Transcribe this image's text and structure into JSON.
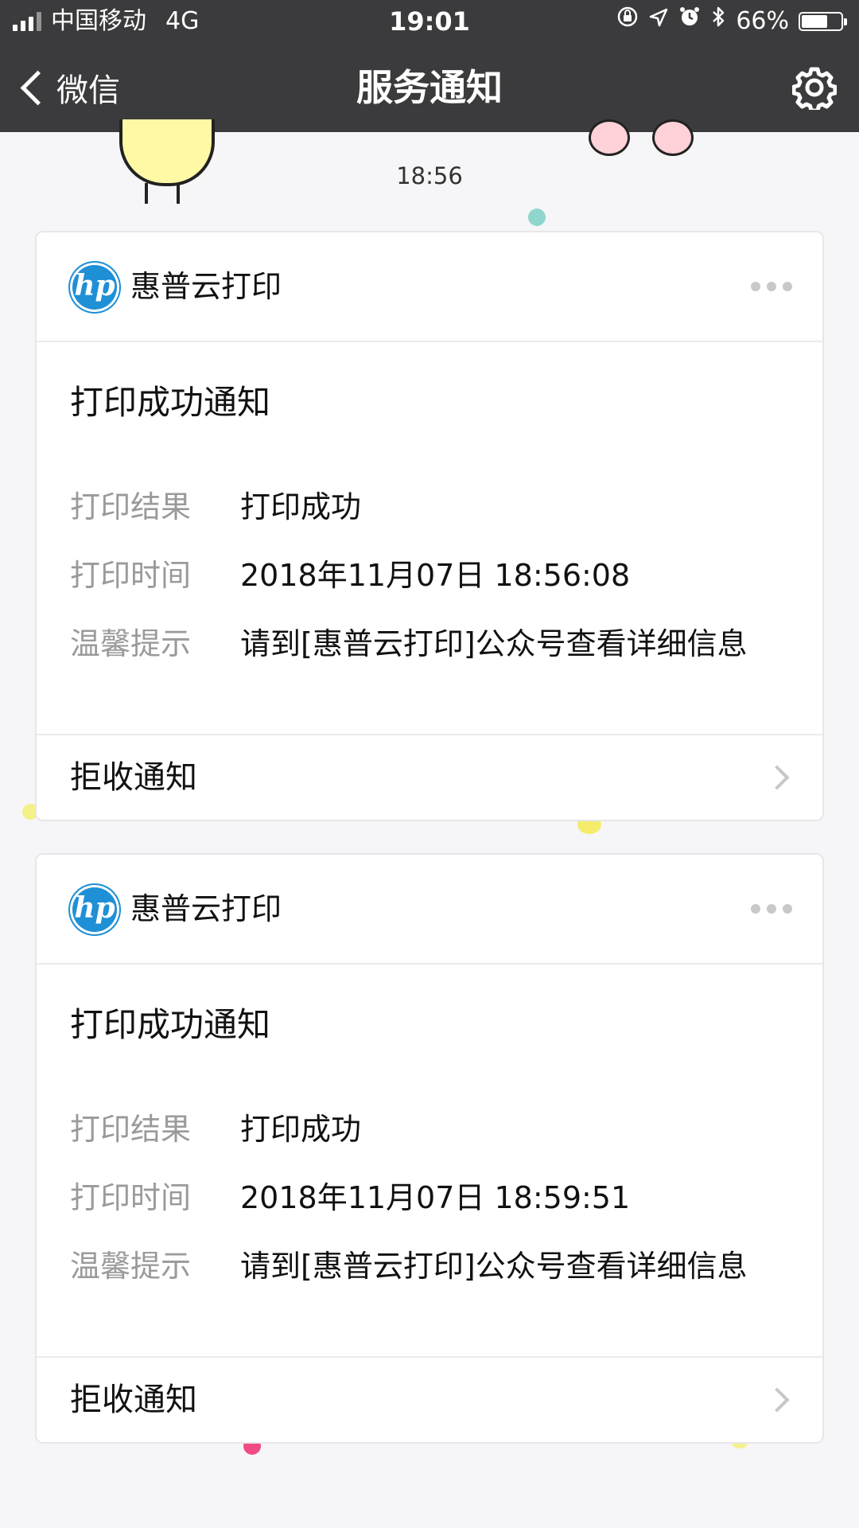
{
  "status_bar": {
    "carrier": "中国移动",
    "network": "4G",
    "time": "19:01",
    "battery": "66%",
    "battery_level": 0.66,
    "icons": [
      "signal-icon",
      "orientation-lock-icon",
      "location-icon",
      "alarm-icon",
      "bluetooth-icon",
      "battery-icon"
    ]
  },
  "nav": {
    "back_label": "微信",
    "title": "服务通知",
    "settings_icon": "gear-icon"
  },
  "conversation": {
    "timestamp": "18:56"
  },
  "cards": [
    {
      "source": "惠普云打印",
      "logo": "hp",
      "title": "打印成功通知",
      "fields": [
        {
          "key": "打印结果",
          "value": "打印成功"
        },
        {
          "key": "打印时间",
          "value": "2018年11月07日 18:56:08"
        },
        {
          "key": "温馨提示",
          "value": "请到[惠普云打印]公众号查看详细信息"
        }
      ],
      "footer": "拒收通知"
    },
    {
      "source": "惠普云打印",
      "logo": "hp",
      "title": "打印成功通知",
      "fields": [
        {
          "key": "打印结果",
          "value": "打印成功"
        },
        {
          "key": "打印时间",
          "value": "2018年11月07日 18:59:51"
        },
        {
          "key": "温馨提示",
          "value": "请到[惠普云打印]公众号查看详细信息"
        }
      ],
      "footer": "拒收通知"
    }
  ],
  "colors": {
    "nav_bg": "#3b3b3d",
    "page_bg": "#f6f6f8",
    "hp_blue": "#1f8fd6",
    "label_gray": "#9a9a9d"
  }
}
